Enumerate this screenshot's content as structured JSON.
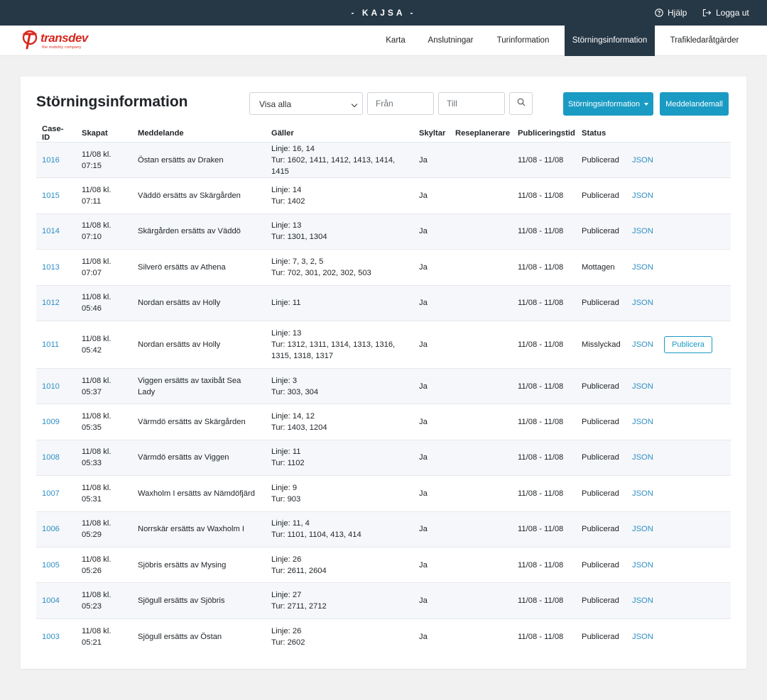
{
  "topbar": {
    "title": "- KAJSA -",
    "help_label": "Hjälp",
    "logout_label": "Logga ut"
  },
  "logo": {
    "brand": "transdev",
    "tagline": "the mobility company"
  },
  "nav": [
    {
      "label": "Karta",
      "active": false
    },
    {
      "label": "Anslutningar",
      "active": false
    },
    {
      "label": "Turinformation",
      "active": false
    },
    {
      "label": "Störningsinformation",
      "active": true
    },
    {
      "label": "Trafikledaråtgärder",
      "active": false
    }
  ],
  "page": {
    "title": "Störningsinformation",
    "filter_value": "Visa alla",
    "from_placeholder": "Från",
    "to_placeholder": "Till",
    "dropdown_button": "Störningsinformation",
    "template_button": "Meddelandemall"
  },
  "table": {
    "headers": [
      "Case-ID",
      "Skapat",
      "Meddelande",
      "Gäller",
      "Skyltar",
      "Reseplanerare",
      "Publiceringstid",
      "Status",
      "",
      ""
    ],
    "rows": [
      {
        "id": "1016",
        "created_date": "11/08 kl.",
        "created_time": "07:15",
        "message": "Östan ersätts av Draken",
        "line": "Linje: 16, 14",
        "trips": "Tur: 1602, 1411, 1412, 1413, 1414, 1415",
        "signs": "Ja",
        "planner": "",
        "pubtime": "11/08 - 11/08",
        "status": "Publicerad",
        "json": "JSON",
        "action": ""
      },
      {
        "id": "1015",
        "created_date": "11/08 kl.",
        "created_time": "07:11",
        "message": "Väddö ersätts av Skärgården",
        "line": "Linje: 14",
        "trips": "Tur: 1402",
        "signs": "Ja",
        "planner": "",
        "pubtime": "11/08 - 11/08",
        "status": "Publicerad",
        "json": "JSON",
        "action": ""
      },
      {
        "id": "1014",
        "created_date": "11/08 kl.",
        "created_time": "07:10",
        "message": "Skärgården ersätts av Väddö",
        "line": "Linje: 13",
        "trips": "Tur: 1301, 1304",
        "signs": "Ja",
        "planner": "",
        "pubtime": "11/08 - 11/08",
        "status": "Publicerad",
        "json": "JSON",
        "action": ""
      },
      {
        "id": "1013",
        "created_date": "11/08 kl.",
        "created_time": "07:07",
        "message": "Silverö ersätts av Athena",
        "line": "Linje: 7, 3, 2, 5",
        "trips": "Tur: 702, 301, 202, 302, 503",
        "signs": "Ja",
        "planner": "",
        "pubtime": "11/08 - 11/08",
        "status": "Mottagen",
        "json": "JSON",
        "action": ""
      },
      {
        "id": "1012",
        "created_date": "11/08 kl.",
        "created_time": "05:46",
        "message": "Nordan ersätts av Holly",
        "line": "Linje: 11",
        "trips": "",
        "signs": "Ja",
        "planner": "",
        "pubtime": "11/08 - 11/08",
        "status": "Publicerad",
        "json": "JSON",
        "action": ""
      },
      {
        "id": "1011",
        "created_date": "11/08 kl.",
        "created_time": "05:42",
        "message": "Nordan ersätts av Holly",
        "line": "Linje: 13",
        "trips": "Tur: 1312, 1311, 1314, 1313, 1316, 1315, 1318, 1317",
        "signs": "Ja",
        "planner": "",
        "pubtime": "11/08 - 11/08",
        "status": "Misslyckad",
        "json": "JSON",
        "action": "Publicera"
      },
      {
        "id": "1010",
        "created_date": "11/08 kl.",
        "created_time": "05:37",
        "message": "Viggen ersätts av taxibåt Sea Lady",
        "line": "Linje: 3",
        "trips": "Tur: 303, 304",
        "signs": "Ja",
        "planner": "",
        "pubtime": "11/08 - 11/08",
        "status": "Publicerad",
        "json": "JSON",
        "action": ""
      },
      {
        "id": "1009",
        "created_date": "11/08 kl.",
        "created_time": "05:35",
        "message": "Värmdö ersätts av Skärgården",
        "line": "Linje: 14, 12",
        "trips": "Tur: 1403, 1204",
        "signs": "Ja",
        "planner": "",
        "pubtime": "11/08 - 11/08",
        "status": "Publicerad",
        "json": "JSON",
        "action": ""
      },
      {
        "id": "1008",
        "created_date": "11/08 kl.",
        "created_time": "05:33",
        "message": "Värmdö ersätts av Viggen",
        "line": "Linje: 11",
        "trips": "Tur: 1102",
        "signs": "Ja",
        "planner": "",
        "pubtime": "11/08 - 11/08",
        "status": "Publicerad",
        "json": "JSON",
        "action": ""
      },
      {
        "id": "1007",
        "created_date": "11/08 kl.",
        "created_time": "05:31",
        "message": "Waxholm I ersätts av Nämdöfjärd",
        "line": "Linje: 9",
        "trips": "Tur: 903",
        "signs": "Ja",
        "planner": "",
        "pubtime": "11/08 - 11/08",
        "status": "Publicerad",
        "json": "JSON",
        "action": ""
      },
      {
        "id": "1006",
        "created_date": "11/08 kl.",
        "created_time": "05:29",
        "message": "Norrskär ersätts av Waxholm I",
        "line": "Linje: 11, 4",
        "trips": "Tur: 1101, 1104, 413, 414",
        "signs": "Ja",
        "planner": "",
        "pubtime": "11/08 - 11/08",
        "status": "Publicerad",
        "json": "JSON",
        "action": ""
      },
      {
        "id": "1005",
        "created_date": "11/08 kl.",
        "created_time": "05:26",
        "message": "Sjöbris ersätts av Mysing",
        "line": "Linje: 26",
        "trips": "Tur: 2611, 2604",
        "signs": "Ja",
        "planner": "",
        "pubtime": "11/08 - 11/08",
        "status": "Publicerad",
        "json": "JSON",
        "action": ""
      },
      {
        "id": "1004",
        "created_date": "11/08 kl.",
        "created_time": "05:23",
        "message": "Sjögull ersätts av Sjöbris",
        "line": "Linje: 27",
        "trips": "Tur: 2711, 2712",
        "signs": "Ja",
        "planner": "",
        "pubtime": "11/08 - 11/08",
        "status": "Publicerad",
        "json": "JSON",
        "action": ""
      },
      {
        "id": "1003",
        "created_date": "11/08 kl.",
        "created_time": "05:21",
        "message": "Sjögull ersätts av Östan",
        "line": "Linje: 26",
        "trips": "Tur: 2602",
        "signs": "Ja",
        "planner": "",
        "pubtime": "11/08 - 11/08",
        "status": "Publicerad",
        "json": "JSON",
        "action": ""
      }
    ]
  },
  "colors": {
    "topbar_bg": "#263745",
    "accent": "#1a9bc4",
    "link": "#2e8fc4",
    "brand_red": "#d7281e"
  },
  "icons": {
    "help": "question-circle-icon",
    "logout": "sign-out-icon",
    "search": "search-icon",
    "logo": "transdev-logo-icon"
  }
}
